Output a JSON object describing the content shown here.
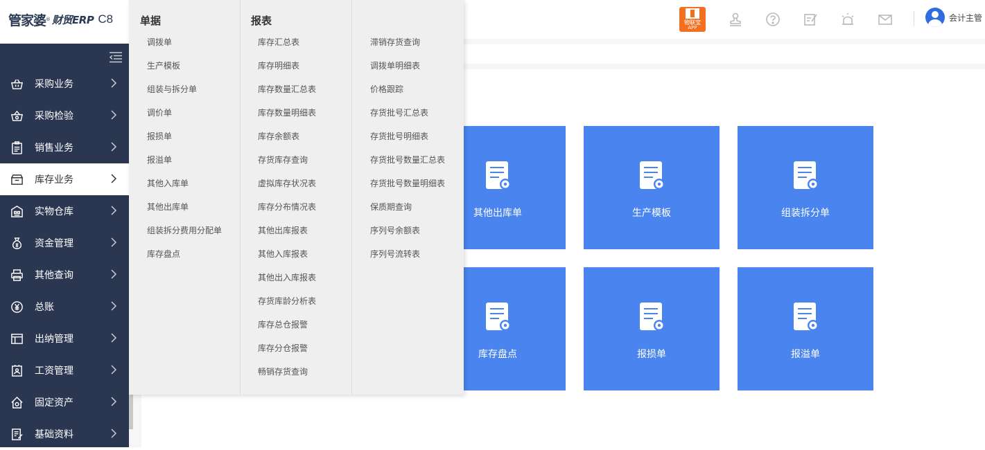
{
  "header": {
    "logo_main": "管家婆",
    "logo_reg": "®",
    "logo_sub": "财贸ERP",
    "logo_version": "C8",
    "app_badge_line1": "物联宝",
    "app_badge_line2": "APP",
    "icons": [
      "stamp-icon",
      "help-icon",
      "edit-icon",
      "alarm-icon",
      "mail-icon"
    ],
    "user_name": "会计主管"
  },
  "sidebar": {
    "items": [
      {
        "label": "采购业务",
        "icon": "basket-icon",
        "active": false
      },
      {
        "label": "采购检验",
        "icon": "inspect-basket-icon",
        "active": false
      },
      {
        "label": "销售业务",
        "icon": "clipboard-icon",
        "active": false
      },
      {
        "label": "库存业务",
        "icon": "inventory-box-icon",
        "active": true
      },
      {
        "label": "实物仓库",
        "icon": "warehouse-icon",
        "active": false
      },
      {
        "label": "资金管理",
        "icon": "money-bag-icon",
        "active": false
      },
      {
        "label": "其他查询",
        "icon": "printer-icon",
        "active": false
      },
      {
        "label": "总账",
        "icon": "yuan-icon",
        "active": false
      },
      {
        "label": "出纳管理",
        "icon": "layout-icon",
        "active": false
      },
      {
        "label": "工资管理",
        "icon": "payroll-icon",
        "active": false
      },
      {
        "label": "固定资产",
        "icon": "home-asset-icon",
        "active": false
      },
      {
        "label": "基础资料",
        "icon": "document-edit-icon",
        "active": false
      }
    ]
  },
  "dropdown": {
    "col1_title": "单据",
    "col1_items": [
      "调拨单",
      "生产模板",
      "组装与拆分单",
      "调价单",
      "报损单",
      "报溢单",
      "其他入库单",
      "其他出库单",
      "组装拆分费用分配单",
      "库存盘点"
    ],
    "col2_title": "报表",
    "col2_items": [
      "库存汇总表",
      "库存明细表",
      "库存数量汇总表",
      "库存数量明细表",
      "库存余额表",
      "存货库存查询",
      "虚拟库存状况表",
      "库存分布情况表",
      "其他出库报表",
      "其他入库报表",
      "其他出入库报表",
      "存货库龄分析表",
      "库存总仓报警",
      "库存分仓报警",
      "畅销存货查询"
    ],
    "col3_items": [
      "滞销存货查询",
      "调拨单明细表",
      "价格跟踪",
      "存货批号汇总表",
      "存货批号明细表",
      "存货批号数量汇总表",
      "存货批号数量明细表",
      "保质期查询",
      "序列号余额表",
      "序列号流转表"
    ]
  },
  "tiles": [
    {
      "label": "其他出库单"
    },
    {
      "label": "生产模板"
    },
    {
      "label": "组装拆分单"
    },
    {
      "label": "库存盘点"
    },
    {
      "label": "报损单"
    },
    {
      "label": "报溢单"
    }
  ],
  "colors": {
    "sidebar_bg": "#2b3650",
    "tile_bg": "#4a84ef",
    "dropdown_bg": "#efefef",
    "app_badge": "#f37021",
    "avatar": "#2f6ce0"
  }
}
